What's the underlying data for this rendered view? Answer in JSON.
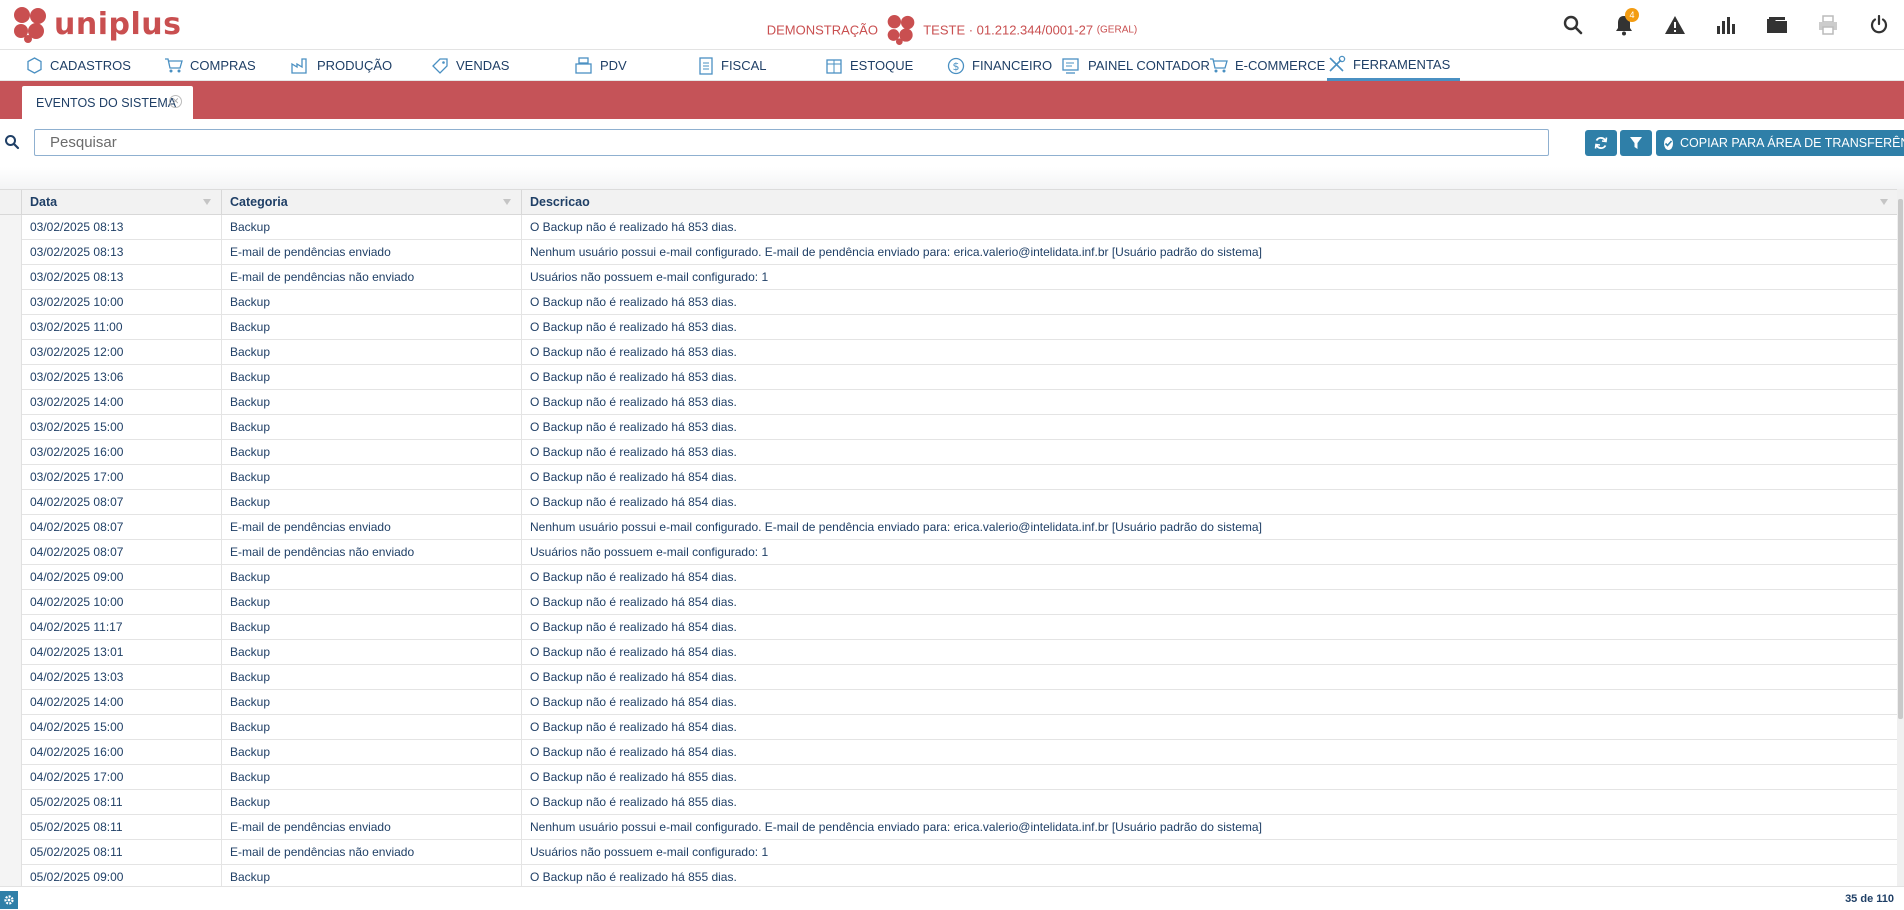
{
  "app": {
    "logo_text": "uniplus"
  },
  "company": {
    "mode": "DEMONSTRAÇÃO",
    "name": "TESTE · 01.212.344/0001-27",
    "branch": "(GERAL)"
  },
  "notifications": {
    "count": "4"
  },
  "menu": [
    {
      "label": "CADASTROS",
      "icon": "cube-icon"
    },
    {
      "label": "COMPRAS",
      "icon": "cart-icon"
    },
    {
      "label": "PRODUÇÃO",
      "icon": "factory-icon"
    },
    {
      "label": "VENDAS",
      "icon": "tag-icon"
    },
    {
      "label": "PDV",
      "icon": "register-icon"
    },
    {
      "label": "FISCAL",
      "icon": "document-icon"
    },
    {
      "label": "ESTOQUE",
      "icon": "box-icon"
    },
    {
      "label": "FINANCEIRO",
      "icon": "dollar-icon"
    },
    {
      "label": "PAINEL CONTADOR",
      "icon": "accountant-icon"
    },
    {
      "label": "E-COMMERCE",
      "icon": "cart-icon"
    },
    {
      "label": "FERRAMENTAS",
      "icon": "tools-icon",
      "active": true
    }
  ],
  "tab": {
    "label": "EVENTOS DO SISTEMA"
  },
  "search": {
    "placeholder": "Pesquisar"
  },
  "toolbar": {
    "copy_label": "COPIAR PARA ÁREA DE TRANSFERÊNCIA"
  },
  "grid": {
    "columns": [
      "Data",
      "Categoria",
      "Descricao"
    ],
    "rows": [
      [
        "03/02/2025 08:13",
        "Backup",
        "O Backup não é realizado há 853 dias."
      ],
      [
        "03/02/2025 08:13",
        "E-mail de pendências enviado",
        "Nenhum usuário possui e-mail configurado. E-mail de pendência enviado para: erica.valerio@intelidata.inf.br [Usuário padrão do sistema]"
      ],
      [
        "03/02/2025 08:13",
        "E-mail de pendências não enviado",
        "Usuários não possuem e-mail configurado: 1"
      ],
      [
        "03/02/2025 10:00",
        "Backup",
        "O Backup não é realizado há 853 dias."
      ],
      [
        "03/02/2025 11:00",
        "Backup",
        "O Backup não é realizado há 853 dias."
      ],
      [
        "03/02/2025 12:00",
        "Backup",
        "O Backup não é realizado há 853 dias."
      ],
      [
        "03/02/2025 13:06",
        "Backup",
        "O Backup não é realizado há 853 dias."
      ],
      [
        "03/02/2025 14:00",
        "Backup",
        "O Backup não é realizado há 853 dias."
      ],
      [
        "03/02/2025 15:00",
        "Backup",
        "O Backup não é realizado há 853 dias."
      ],
      [
        "03/02/2025 16:00",
        "Backup",
        "O Backup não é realizado há 853 dias."
      ],
      [
        "03/02/2025 17:00",
        "Backup",
        "O Backup não é realizado há 854 dias."
      ],
      [
        "04/02/2025 08:07",
        "Backup",
        "O Backup não é realizado há 854 dias."
      ],
      [
        "04/02/2025 08:07",
        "E-mail de pendências enviado",
        "Nenhum usuário possui e-mail configurado. E-mail de pendência enviado para: erica.valerio@intelidata.inf.br [Usuário padrão do sistema]"
      ],
      [
        "04/02/2025 08:07",
        "E-mail de pendências não enviado",
        "Usuários não possuem e-mail configurado: 1"
      ],
      [
        "04/02/2025 09:00",
        "Backup",
        "O Backup não é realizado há 854 dias."
      ],
      [
        "04/02/2025 10:00",
        "Backup",
        "O Backup não é realizado há 854 dias."
      ],
      [
        "04/02/2025 11:17",
        "Backup",
        "O Backup não é realizado há 854 dias."
      ],
      [
        "04/02/2025 13:01",
        "Backup",
        "O Backup não é realizado há 854 dias."
      ],
      [
        "04/02/2025 13:03",
        "Backup",
        "O Backup não é realizado há 854 dias."
      ],
      [
        "04/02/2025 14:00",
        "Backup",
        "O Backup não é realizado há 854 dias."
      ],
      [
        "04/02/2025 15:00",
        "Backup",
        "O Backup não é realizado há 854 dias."
      ],
      [
        "04/02/2025 16:00",
        "Backup",
        "O Backup não é realizado há 854 dias."
      ],
      [
        "04/02/2025 17:00",
        "Backup",
        "O Backup não é realizado há 855 dias."
      ],
      [
        "05/02/2025 08:11",
        "Backup",
        "O Backup não é realizado há 855 dias."
      ],
      [
        "05/02/2025 08:11",
        "E-mail de pendências enviado",
        "Nenhum usuário possui e-mail configurado. E-mail de pendência enviado para: erica.valerio@intelidata.inf.br [Usuário padrão do sistema]"
      ],
      [
        "05/02/2025 08:11",
        "E-mail de pendências não enviado",
        "Usuários não possuem e-mail configurado: 1"
      ],
      [
        "05/02/2025 09:00",
        "Backup",
        "O Backup não é realizado há 855 dias."
      ]
    ]
  },
  "footer": {
    "count": "35 de 110"
  },
  "colors": {
    "brand": "#c94f50",
    "tab_strip": "#c55358",
    "accent": "#2f7fa8",
    "menu_text": "#1f3f66"
  }
}
